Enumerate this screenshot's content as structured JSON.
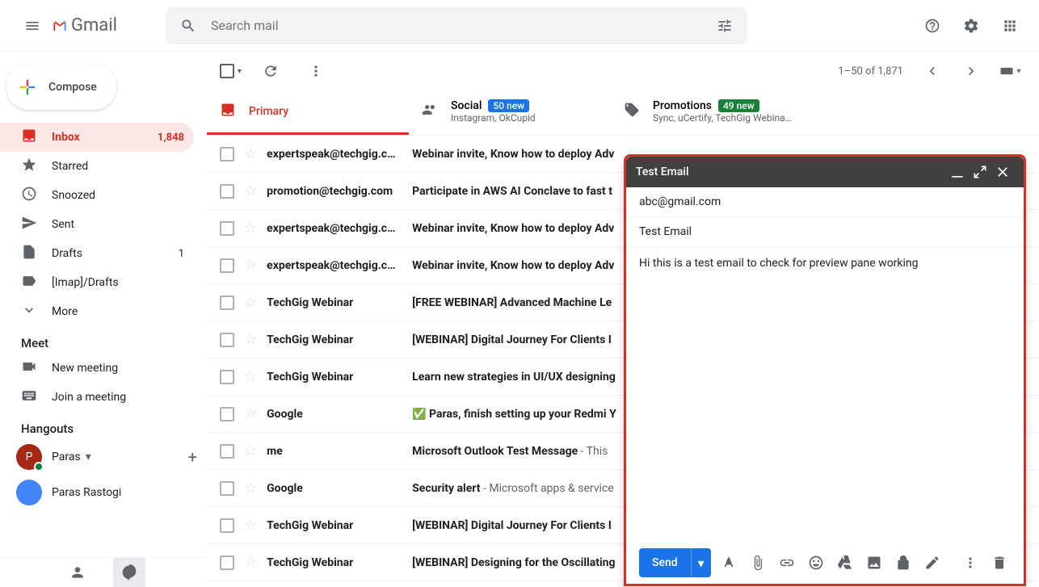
{
  "header": {
    "logo_text": "Gmail",
    "search_placeholder": "Search mail"
  },
  "compose_btn": "Compose",
  "sidebar": {
    "items": [
      {
        "label": "Inbox",
        "count": "1,848"
      },
      {
        "label": "Starred",
        "count": ""
      },
      {
        "label": "Snoozed",
        "count": ""
      },
      {
        "label": "Sent",
        "count": ""
      },
      {
        "label": "Drafts",
        "count": "1"
      },
      {
        "label": "[Imap]/Drafts",
        "count": ""
      },
      {
        "label": "More",
        "count": ""
      }
    ],
    "meet_label": "Meet",
    "meet_new": "New meeting",
    "meet_join": "Join a meeting",
    "hangouts_label": "Hangouts",
    "user_name": "Paras",
    "user_initial": "P",
    "contact_name": "Paras Rastogi"
  },
  "toolbar": {
    "pagination": "1–50 of 1,871"
  },
  "tabs": [
    {
      "title": "Primary",
      "badge": "",
      "sub": ""
    },
    {
      "title": "Social",
      "badge": "50 new",
      "sub": "Instagram, OkCupid"
    },
    {
      "title": "Promotions",
      "badge": "49 new",
      "sub": "Sync, uCertify, TechGig Webina…"
    }
  ],
  "emails": [
    {
      "sender": "expertspeak@techgig.c…",
      "subject": "Webinar invite, Know how to deploy Adv",
      "snippet": ""
    },
    {
      "sender": "promotion@techgig.com",
      "subject": "Participate in AWS AI Conclave to fast t",
      "snippet": ""
    },
    {
      "sender": "expertspeak@techgig.c…",
      "subject": "Webinar invite, Know how to deploy Adv",
      "snippet": ""
    },
    {
      "sender": "expertspeak@techgig.c…",
      "subject": "Webinar invite, Know how to deploy Adv",
      "snippet": ""
    },
    {
      "sender": "TechGig Webinar",
      "subject": "[FREE WEBINAR] Advanced Machine Le",
      "snippet": ""
    },
    {
      "sender": "TechGig Webinar",
      "subject": "[WEBINAR] Digital Journey For Clients I",
      "snippet": ""
    },
    {
      "sender": "TechGig Webinar",
      "subject": "Learn new strategies in UI/UX designing",
      "snippet": ""
    },
    {
      "sender": "Google",
      "subject": "✅ Paras, finish setting up your Redmi Y",
      "snippet": ""
    },
    {
      "sender": "me",
      "subject": "Microsoft Outlook Test Message",
      "snippet": " - This"
    },
    {
      "sender": "Google",
      "subject": "Security alert",
      "snippet": " - Microsoft apps & service"
    },
    {
      "sender": "TechGig Webinar",
      "subject": "[WEBINAR] Digital Journey For Clients I",
      "snippet": ""
    },
    {
      "sender": "TechGig Webinar",
      "subject": "[WEBINAR] Designing for the Oscillating",
      "snippet": ""
    }
  ],
  "compose": {
    "title": "Test Email",
    "to": "abc@gmail.com",
    "subject": "Test Email",
    "body": "Hi this is a test email to check for preview pane working",
    "send_label": "Send"
  }
}
